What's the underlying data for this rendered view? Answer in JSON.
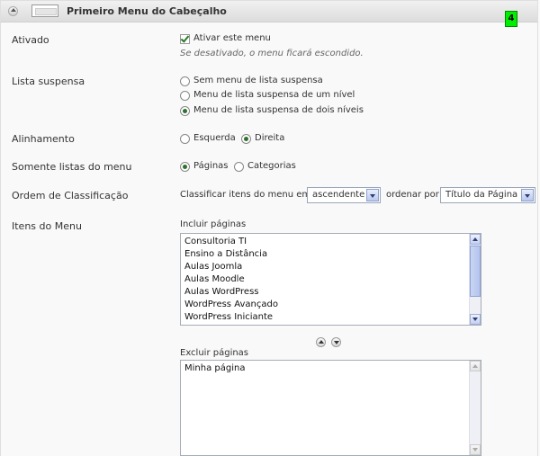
{
  "header": {
    "title": "Primeiro Menu do Cabeçalho",
    "badge": "4"
  },
  "ativado": {
    "label": "Ativado",
    "checkbox_label": "Ativar este menu",
    "hint": "Se desativado, o menu ficará escondido."
  },
  "lista_suspensa": {
    "label": "Lista suspensa",
    "options": [
      "Sem menu de lista suspensa",
      "Menu de lista suspensa de um nível",
      "Menu de lista suspensa de dois níveis"
    ],
    "selected_index": 2
  },
  "alinhamento": {
    "label": "Alinhamento",
    "options": [
      "Esquerda",
      "Direita"
    ],
    "selected_index": 1
  },
  "somente": {
    "label": "Somente listas do menu",
    "options": [
      "Páginas",
      "Categorias"
    ],
    "selected_index": 0
  },
  "ordem": {
    "label": "Ordem de Classificação",
    "prefix": "Classificar itens do menu em",
    "sort_direction": "ascendente",
    "middle": "ordenar por",
    "sort_by": "Título da Página"
  },
  "itens": {
    "label": "Itens do Menu",
    "include_label": "Incluir páginas",
    "include_items": [
      "Consultoria TI",
      "Ensino a Distância",
      "Aulas Joomla",
      "Aulas Moodle",
      "Aulas WordPress",
      "WordPress Avançado",
      "WordPress Iniciante"
    ],
    "exclude_label": "Excluir páginas",
    "exclude_items": [
      "Minha página"
    ]
  }
}
